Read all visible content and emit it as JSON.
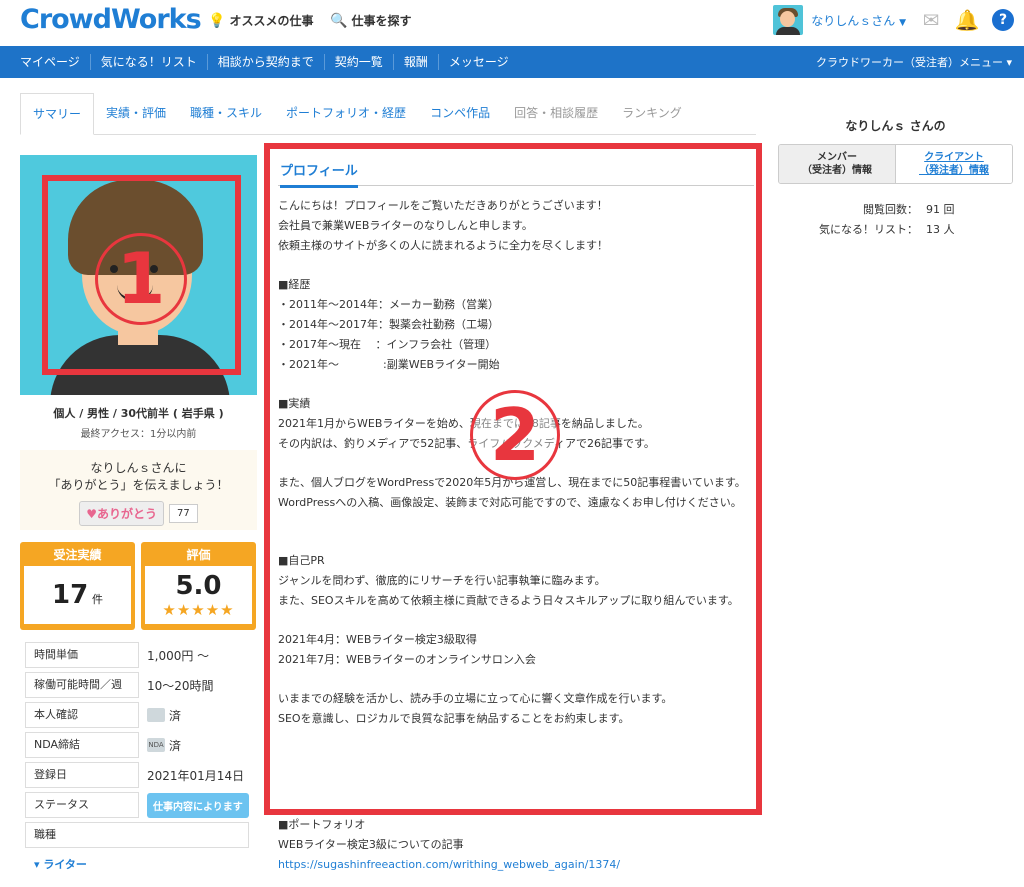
{
  "header": {
    "logo": "CrowdWorks",
    "recommend": "オススメの仕事",
    "search": "仕事を探す",
    "user_name": "なりしんｓさん"
  },
  "navbar": {
    "items": [
      "マイページ",
      "気になる！リスト",
      "相談から契約まで",
      "契約一覧",
      "報酬",
      "メッセージ"
    ],
    "menu_right": "クラウドワーカー（受注者）メニュー"
  },
  "tabs": [
    "サマリー",
    "実績・評価",
    "職種・スキル",
    "ポートフォリオ・経歴",
    "コンペ作品",
    "回答・相談履歴",
    "ランキング"
  ],
  "left": {
    "mark_number": "1",
    "profile_line": "個人 / 男性 / 30代前半 ( 岩手県 )",
    "last_access": "最終アクセス：1分以内前",
    "thanks_line1": "なりしんｓさんに",
    "thanks_line2": "「ありがとう」を伝えましょう！",
    "thanks_button": "♥ありがとう",
    "thanks_count": "77",
    "stat_orders_label": "受注実績",
    "stat_orders_value": "17",
    "stat_orders_unit": "件",
    "stat_rating_label": "評価",
    "stat_rating_value": "5.0",
    "stars": "★★★★★",
    "info": [
      {
        "k": "時間単価",
        "v": "1,000円 〜"
      },
      {
        "k": "稼働可能時間／週",
        "v": "10〜20時間"
      },
      {
        "k": "本人確認",
        "v": "済"
      },
      {
        "k": "NDA締結",
        "v": "済"
      },
      {
        "k": "登録日",
        "v": "2021年01月14日"
      },
      {
        "k": "ステータス",
        "v": "仕事内容によります"
      },
      {
        "k": "職種",
        "v": ""
      }
    ],
    "nda_badge": "NDA",
    "writer": "▾ ライター"
  },
  "profile": {
    "title": "プロフィール",
    "mark_number": "2",
    "paragraphs": [
      "こんにちは！プロフィールをご覧いただきありがとうございます！\n会社員で兼業WEBライターのなりしんと申します。\n依頼主様のサイトが多くの人に読まれるように全力を尽くします！",
      "■経歴\n・2011年〜2014年：メーカー勤務（営業）\n・2014年〜2017年：製薬会社勤務（工場）\n・2017年〜現在　 ：インフラ会社（管理）\n・2021年〜　　　　:副業WEBライター開始",
      "■実績\n2021年1月からWEBライターを始め、現在までに78記事を納品しました。\nその内訳は、釣りメディアで52記事、ライフハックメディアで26記事です。",
      "また、個人ブログをWordPressで2020年5月から運営し、現在までに50記事程書いています。\nWordPressへの入稿、画像設定、装飾まで対応可能ですので、遠慮なくお申し付けください。",
      "",
      "■自己PR\nジャンルを問わず、徹底的にリサーチを行い記事執筆に臨みます。\nまた、SEOスキルを高めて依頼主様に貢献できるよう日々スキルアップに取り組んでいます。",
      "2021年4月：WEBライター検定3級取得\n2021年7月：WEBライターのオンラインサロン入会",
      "いままでの経験を活かし、読み手の立場に立って心に響く文章作成を行います。\nSEOを意識し、ロジカルで良質な記事を納品することをお約束します。"
    ],
    "portfolio_heading": "■ポートフォリオ",
    "portfolio_item": "WEBライター検定3級についての記事",
    "portfolio_link": "https://sugashinfreeaction.com/writhing_webweb_again/1374/"
  },
  "right": {
    "title": "なりしんｓ さんの",
    "tab_member": "メンバー\n（受注者）情報",
    "tab_client": "クライアント\n（発注者）情報",
    "views_label": "閲覧回数：",
    "views_value": "91 回",
    "fav_label": "気になる！リスト：",
    "fav_value": "13 人"
  },
  "colors": {
    "brand_blue": "#1e73c8",
    "accent_orange": "#f5a623",
    "annotation_red": "#e8363e"
  }
}
